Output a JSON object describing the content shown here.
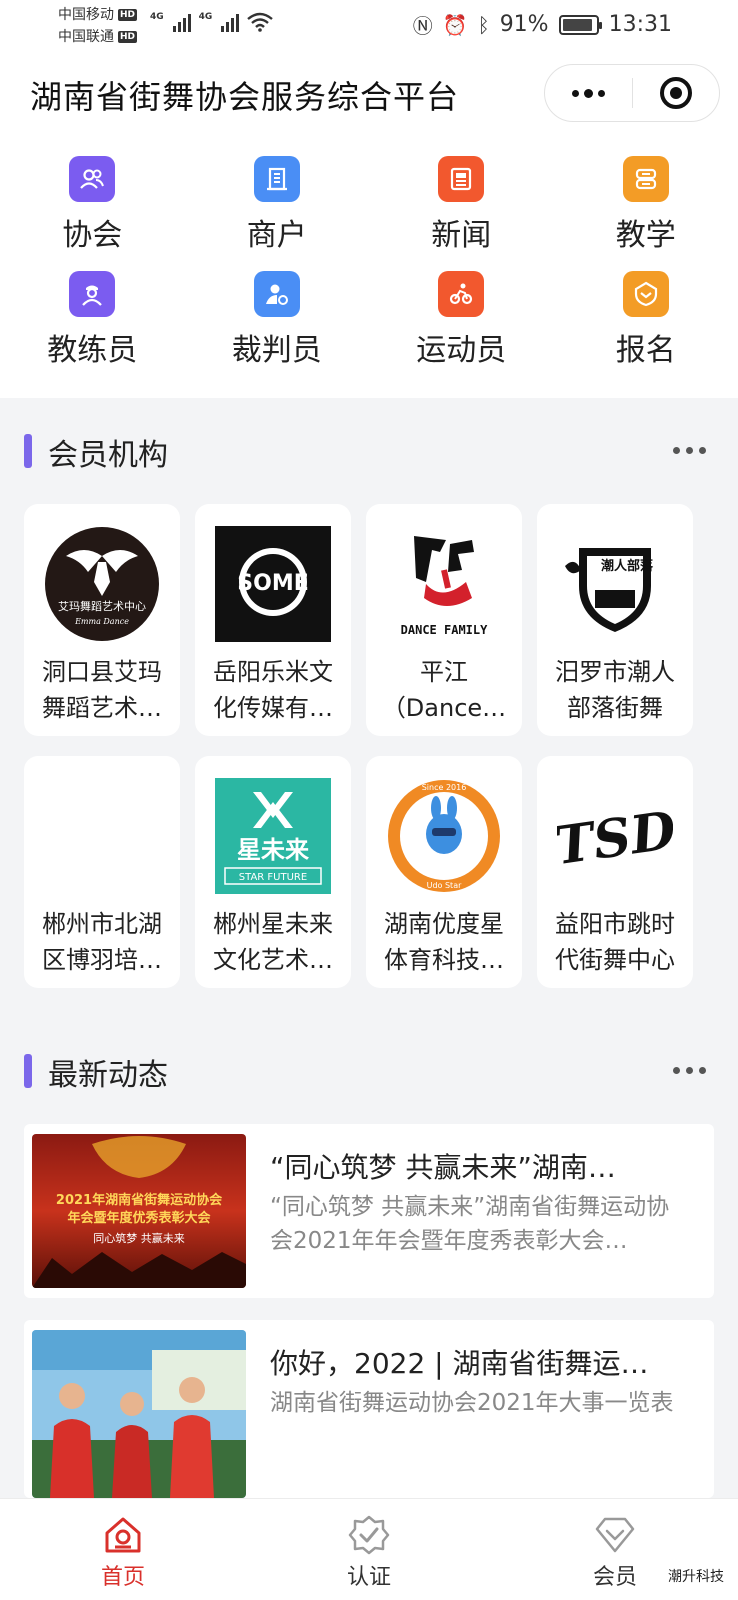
{
  "status_bar": {
    "carrier_1": "中国移动",
    "carrier_2": "中国联通",
    "hd_label": "HD",
    "network_1": "4G",
    "network_2": "4G",
    "battery_percent": "91%",
    "battery_level": 0.91,
    "time": "13:31"
  },
  "header": {
    "title": "湖南省街舞协会服务综合平台"
  },
  "quick_nav": [
    {
      "label": "协会",
      "icon": "people-icon",
      "color": "#7b5cf0"
    },
    {
      "label": "商户",
      "icon": "building-icon",
      "color": "#4a8ef5"
    },
    {
      "label": "新闻",
      "icon": "newspaper-icon",
      "color": "#f2582e"
    },
    {
      "label": "教学",
      "icon": "book-icon",
      "color": "#f39c26"
    },
    {
      "label": "教练员",
      "icon": "coach-icon",
      "color": "#7b5cf0"
    },
    {
      "label": "裁判员",
      "icon": "referee-icon",
      "color": "#4a8ef5"
    },
    {
      "label": "运动员",
      "icon": "athlete-icon",
      "color": "#f2582e"
    },
    {
      "label": "报名",
      "icon": "signup-icon",
      "color": "#f39c26"
    }
  ],
  "members_section": {
    "title": "会员机构",
    "accent": "#7b67ea",
    "orgs": [
      {
        "name": "洞口县艾玛舞蹈艺术中心",
        "display": "洞口县艾玛舞蹈艺术…",
        "logo_text": "艾玛舞蹈艺术中心",
        "logo_sub": "Emma Dance"
      },
      {
        "name": "岳阳乐米文化传媒有限公司",
        "display": "岳阳乐米文化传媒有…",
        "logo_text": "SOME"
      },
      {
        "name": "平江（Dance Family）",
        "display": "平江（Dance…",
        "logo_text": "DANCE FAMILY"
      },
      {
        "name": "汨罗市潮人部落街舞",
        "display": "汨罗市潮人部落街舞",
        "logo_text": "潮人部落"
      },
      {
        "name": "郴州市北湖区博羽培训",
        "display": "郴州市北湖区博羽培…",
        "logo_text": ""
      },
      {
        "name": "郴州星未来文化艺术",
        "display": "郴州星未来文化艺术…",
        "logo_text": "星未来",
        "logo_sub": "STAR FUTURE"
      },
      {
        "name": "湖南优度星体育科技",
        "display": "湖南优度星体育科技…",
        "logo_text": "Udo Star",
        "logo_sub": "Since 2016"
      },
      {
        "name": "益阳市跳时代街舞中心",
        "display": "益阳市跳时代街舞中心",
        "logo_text": "TSD"
      }
    ]
  },
  "news_section": {
    "title": "最新动态",
    "items": [
      {
        "title": "“同心筑梦 共赢未来”湖南…",
        "summary": "“同心筑梦 共赢未来”湖南省街舞运动协会2021年年会暨年度秀表彰大会…",
        "thumb_text_1": "2021年湖南省街舞运动协会",
        "thumb_text_2": "年会暨年度优秀表彰大会",
        "thumb_text_3": "同心筑梦 共赢未来"
      },
      {
        "title": "你好，2022 | 湖南省街舞运…",
        "summary": "湖南省街舞运动协会2021年大事一览表"
      }
    ]
  },
  "tab_bar": {
    "tabs": [
      {
        "label": "首页",
        "icon": "home-icon",
        "active": true
      },
      {
        "label": "认证",
        "icon": "verify-icon",
        "active": false
      },
      {
        "label": "会员",
        "icon": "member-diamond-icon",
        "active": false
      }
    ],
    "active_color": "#d9302b"
  },
  "watermark": "潮升科技"
}
